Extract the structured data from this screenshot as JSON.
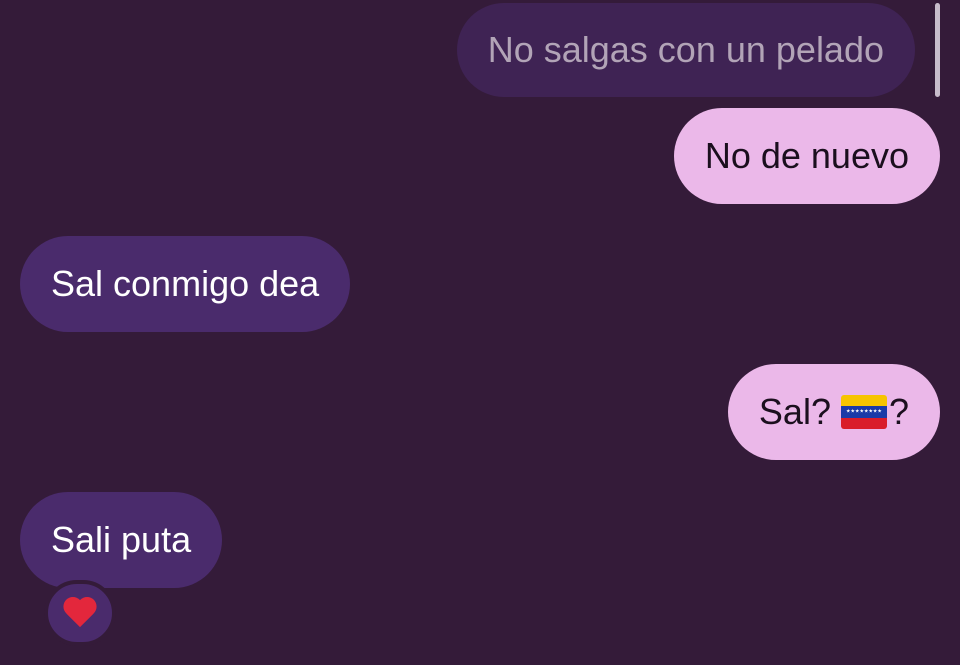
{
  "colors": {
    "background": "#341b39",
    "sent_bubble": "#ebb8e9",
    "received_bubble": "#4a2b6c",
    "quoted_bubble": "#3f2354"
  },
  "messages": [
    {
      "type": "quoted",
      "text": "No salgas con un pelado"
    },
    {
      "type": "sent",
      "text": "No de nuevo"
    },
    {
      "type": "received",
      "text": "Sal conmigo dea"
    },
    {
      "type": "sent",
      "text_before": "Sal?",
      "emoji": "venezuela-flag",
      "text_after": "?"
    },
    {
      "type": "received",
      "text": "Sali puta",
      "reaction": "red-heart"
    }
  ]
}
